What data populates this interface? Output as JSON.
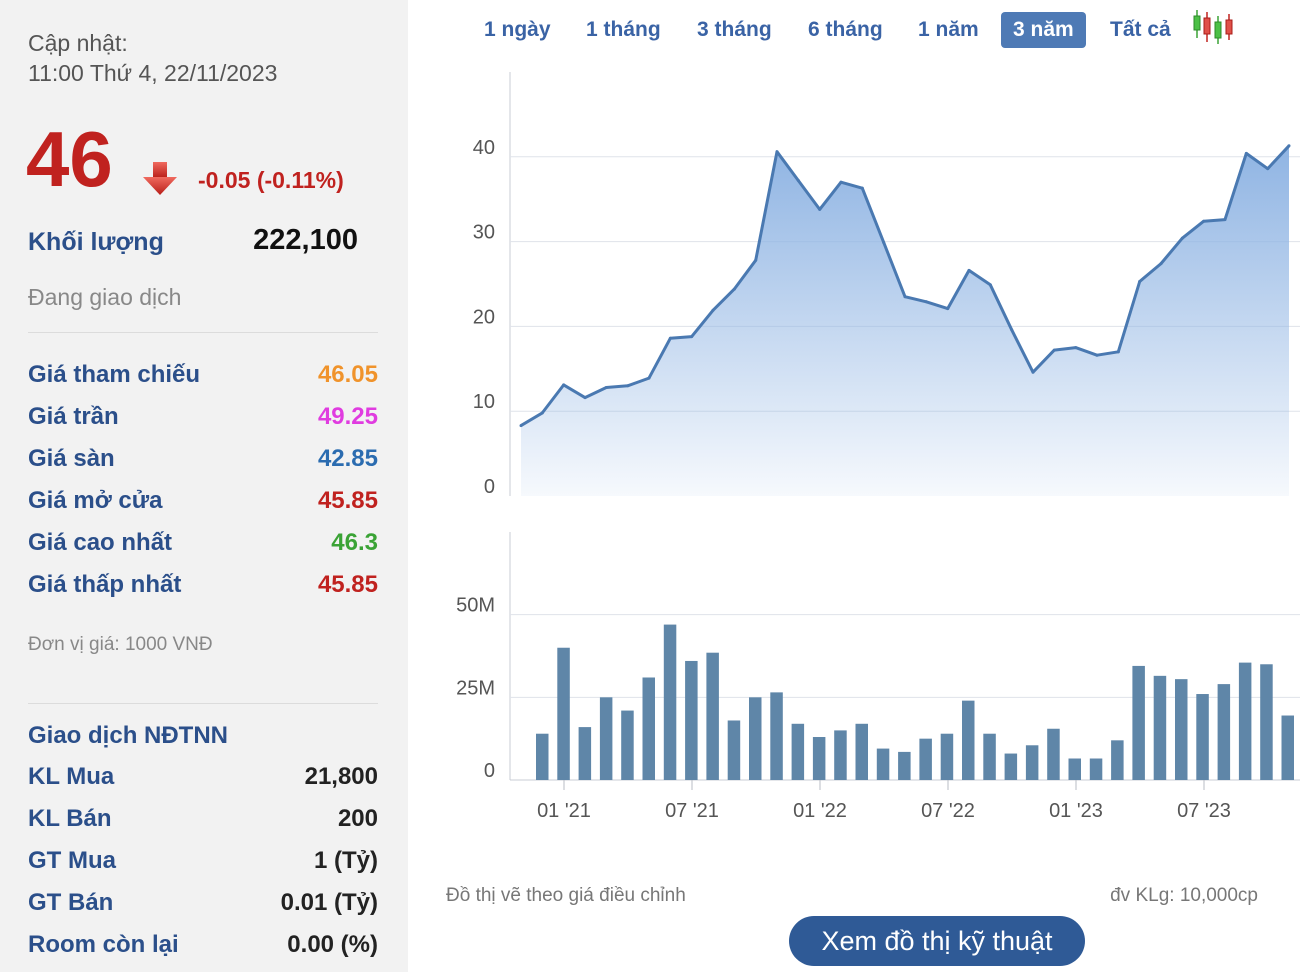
{
  "left": {
    "update_label": "Cập nhật:",
    "update_time": "11:00 Thứ 4, 22/11/2023",
    "price": "46",
    "change": "-0.05 (-0.11%)",
    "volume_label": "Khối lượng",
    "volume_value": "222,100",
    "status": "Đang giao dịch",
    "prices": [
      {
        "label": "Giá tham chiếu",
        "value": "46.05",
        "color": "#f0932b"
      },
      {
        "label": "Giá trần",
        "value": "49.25",
        "color": "#e03ce0"
      },
      {
        "label": "Giá sàn",
        "value": "42.85",
        "color": "#2b6cb0"
      },
      {
        "label": "Giá mở cửa",
        "value": "45.85",
        "color": "#c0221f"
      },
      {
        "label": "Giá cao nhất",
        "value": "46.3",
        "color": "#3aa335"
      },
      {
        "label": "Giá thấp nhất",
        "value": "45.85",
        "color": "#c0221f"
      }
    ],
    "unit_note": "Đơn vị giá: 1000 VNĐ",
    "foreign_title": "Giao dịch NĐTNN",
    "foreign": [
      {
        "label": "KL Mua",
        "value": "21,800"
      },
      {
        "label": "KL Bán",
        "value": "200"
      },
      {
        "label": "GT Mua",
        "value": "1 (Tỷ)"
      },
      {
        "label": "GT Bán",
        "value": "0.01 (Tỷ)"
      },
      {
        "label": "Room còn lại",
        "value": "0.00 (%)"
      }
    ]
  },
  "tabs": [
    "1 ngày",
    "1 tháng",
    "3 tháng",
    "6 tháng",
    "1 năm",
    "3 năm",
    "Tất cả"
  ],
  "active_tab": "3 năm",
  "chart_data": {
    "type": "area",
    "price": {
      "y_ticks": [
        "0",
        "10",
        "20",
        "30",
        "40"
      ],
      "ylim": [
        0,
        50
      ],
      "values": [
        8.3,
        9.8,
        13.1,
        11.6,
        12.8,
        13.0,
        13.9,
        18.6,
        18.8,
        21.9,
        24.4,
        27.8,
        40.6,
        37.2,
        33.8,
        37.0,
        36.3,
        29.9,
        23.5,
        22.9,
        22.1,
        26.6,
        24.9,
        19.6,
        14.6,
        17.2,
        17.5,
        16.6,
        17.0,
        25.3,
        27.4,
        30.4,
        32.4,
        32.6,
        40.4,
        38.6,
        41.3
      ]
    },
    "volume": {
      "y_ticks": [
        "0",
        "25M",
        "50M"
      ],
      "ylim": [
        0,
        75
      ],
      "values": [
        14,
        40,
        16,
        25,
        21,
        31,
        47,
        36,
        38.5,
        18,
        25,
        26.5,
        17,
        13,
        15,
        17,
        9.5,
        8.5,
        12.5,
        14,
        24,
        14,
        8,
        10.5,
        15.5,
        6.5,
        6.5,
        12,
        34.5,
        31.5,
        30.5,
        26,
        29,
        35.5,
        35,
        19.5
      ]
    },
    "x_ticks": [
      "01 '21",
      "07 '21",
      "01 '22",
      "07 '22",
      "01 '23",
      "07 '23"
    ],
    "colors": {
      "line": "#4a79b1",
      "fill": "#8fb4e3",
      "bar": "#5f86a8",
      "grid": "#dfe3ea"
    }
  },
  "notes": {
    "adjusted": "Đồ thị vẽ theo giá điều chỉnh",
    "vol_unit": "đv KLg: 10,000cp"
  },
  "tech_button": "Xem đồ thị kỹ thuật"
}
